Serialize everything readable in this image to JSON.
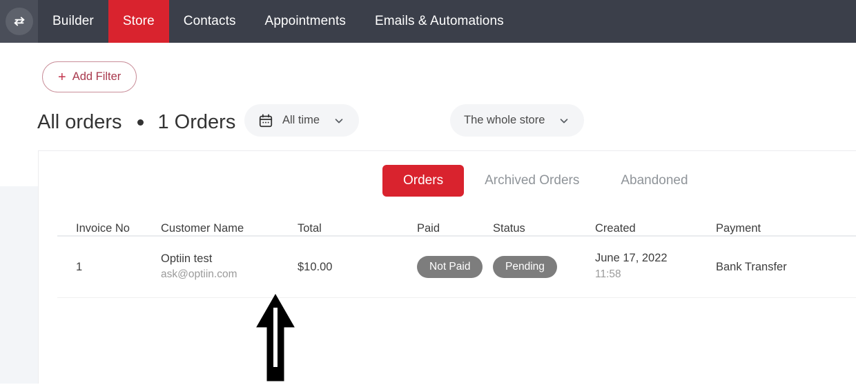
{
  "topnav": {
    "toggle_icon": "swap-horizontal-arrows-icon",
    "items": [
      {
        "label": "Builder",
        "active": false
      },
      {
        "label": "Store",
        "active": true
      },
      {
        "label": "Contacts",
        "active": false
      },
      {
        "label": "Appointments",
        "active": false
      },
      {
        "label": "Emails & Automations",
        "active": false
      }
    ],
    "active_color": "#d9232e",
    "bar_color": "#3b3f4a"
  },
  "toolbar": {
    "add_filter_label": "Add Filter",
    "add_filter_plus": "+",
    "add_filter_color": "#a8384c"
  },
  "header": {
    "title": "All orders",
    "separator_dot": "●",
    "order_count": "1 Orders"
  },
  "filters": {
    "time": {
      "label": "All time",
      "icon": "calendar-icon",
      "chevron": "chevron-down-icon"
    },
    "store": {
      "label": "The whole store",
      "chevron": "chevron-down-icon"
    }
  },
  "tabs": [
    {
      "label": "Orders",
      "active": true
    },
    {
      "label": "Archived Orders",
      "active": false
    },
    {
      "label": "Abandoned",
      "active": false
    }
  ],
  "table": {
    "columns": [
      "Invoice No",
      "Customer Name",
      "Total",
      "Paid",
      "Status",
      "Created",
      "Payment"
    ],
    "rows": [
      {
        "invoice_no": "1",
        "customer_name": "Optiin test",
        "customer_email": "ask@optiin.com",
        "total": "$10.00",
        "paid": "Not Paid",
        "status": "Pending",
        "created_date": "June 17, 2022",
        "created_time": "11:58",
        "payment": "Bank Transfer",
        "badge_color": "#7d7d7d"
      }
    ]
  },
  "annotation": {
    "arrow": "up-arrow-annotation",
    "color": "#000000"
  }
}
